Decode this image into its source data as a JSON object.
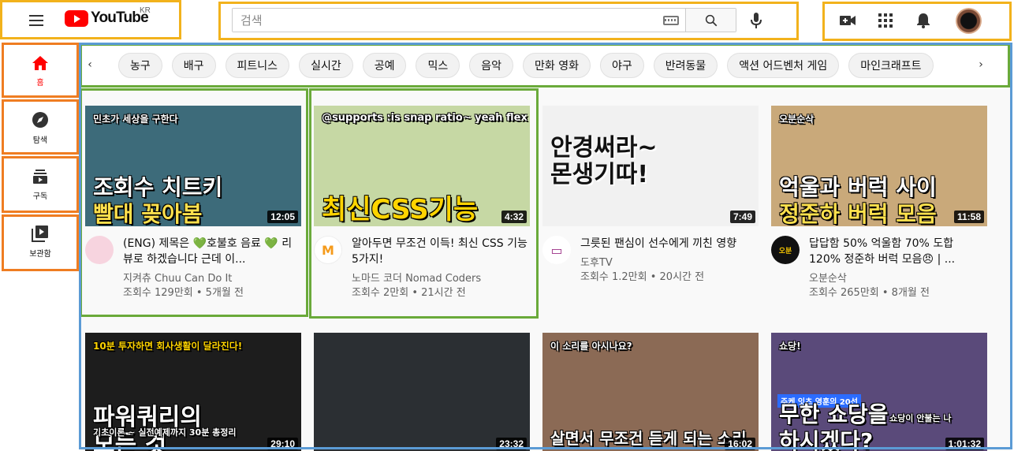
{
  "header": {
    "logo_text": "YouTube",
    "region": "KR",
    "search_placeholder": "검색"
  },
  "sidebar": {
    "items": [
      {
        "label": "홈",
        "icon": "home-icon",
        "active": true
      },
      {
        "label": "탐색",
        "icon": "compass-icon",
        "active": false
      },
      {
        "label": "구독",
        "icon": "subscriptions-icon",
        "active": false
      },
      {
        "label": "보관함",
        "icon": "library-icon",
        "active": false
      }
    ]
  },
  "chips": [
    "농구",
    "배구",
    "피트니스",
    "실시간",
    "공예",
    "믹스",
    "음악",
    "만화 영화",
    "야구",
    "반려동물",
    "액션 어드벤처 게임",
    "마인크래프트"
  ],
  "videos": [
    {
      "title": "(ENG) 제목은 💚호불호 음료 💚 리뷰로 하겠습니다 근데 이...",
      "channel": "지켜츄 Chuu Can Do It",
      "stats": "조회수 129만회 • 5개월 전",
      "duration": "12:05",
      "thumb_lines": [
        "조회수 치트키",
        "빨대 꽂아봄"
      ],
      "thumb_top": "민초가 세상을 구한다",
      "thumb_bg": "#3d6b7a"
    },
    {
      "title": "알아두면 무조건 이득! 최신 CSS 기능 5가지!",
      "channel": "노마드 코더 Nomad Coders",
      "stats": "조회수 2만회 • 21시간 전",
      "duration": "4:32",
      "thumb_lines": [
        "최신CSS기능"
      ],
      "thumb_top": "@supports :is snap ratio~ yeah flex gap~",
      "thumb_bg": "#c6d8a4"
    },
    {
      "title": "그릇된 팬심이 선수에게 끼친 영향",
      "channel": "도후TV",
      "stats": "조회수 1.2만회 • 20시간 전",
      "duration": "7:49",
      "thumb_lines": [
        "안경써라~",
        "몬생기따!"
      ],
      "thumb_top": "",
      "thumb_bg": "#f1f1f1"
    },
    {
      "title": "답답함 50% 억울함 70% 도합 120% 정준하 버럭 모음😠 | ...",
      "channel": "오분순삭",
      "stats": "조회수 265만회 • 8개월 전",
      "duration": "11:58",
      "thumb_lines": [
        "억울과 버럭 사이",
        "정준하 버럭 모음"
      ],
      "thumb_top": "오분순삭",
      "thumb_bg": "#c9a97a"
    },
    {
      "title": "",
      "channel": "",
      "stats": "",
      "duration": "29:10",
      "thumb_lines": [
        "파워쿼리의",
        "모든 것"
      ],
      "thumb_top": "10분 투자하면 회사생활이 달라진다!",
      "thumb_sub": "기초이론 ~ 실전예제까지 30분 총정리",
      "thumb_bg": "#1d1d1d"
    },
    {
      "title": "",
      "channel": "",
      "stats": "",
      "duration": "23:32",
      "thumb_lines": [],
      "thumb_top": "",
      "thumb_bg": "#2b2f33"
    },
    {
      "title": "",
      "channel": "",
      "stats": "",
      "duration": "16:02",
      "thumb_lines": [
        "살면서 무조건 듣게 되는 소리"
      ],
      "thumb_top": "이 소리를 아시나요?",
      "thumb_bg": "#8b6a55"
    },
    {
      "title": "",
      "channel": "",
      "stats": "",
      "duration": "1:01:32",
      "thumb_lines": [
        "무한 쇼당을",
        "하시겠다?"
      ],
      "thumb_top": "쇼당!",
      "thumb_sub": "쇼당이 안불는 나",
      "thumb_tag": "주케 잇츠 영훈의 20선",
      "thumb_bg": "#5a4a7a"
    }
  ]
}
